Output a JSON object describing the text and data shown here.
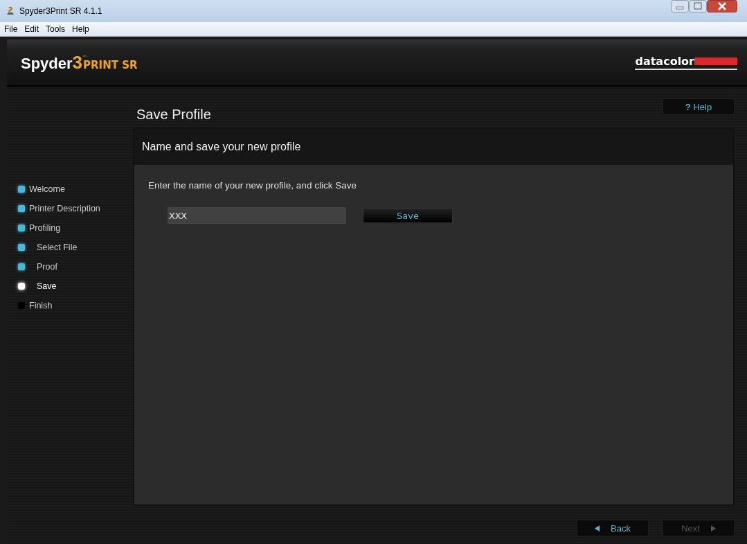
{
  "window": {
    "title": "Spyder3Print SR 4.1.1"
  },
  "menu": [
    "File",
    "Edit",
    "Tools",
    "Help"
  ],
  "logo": {
    "name": "Spyder",
    "number": "3",
    "tm": "™",
    "product": "PRINT SR"
  },
  "brand": "datacolor",
  "steps": [
    {
      "label": "Welcome",
      "kind": "done"
    },
    {
      "label": "Printer Description",
      "kind": "done"
    },
    {
      "label": "Profiling",
      "kind": "done",
      "children": [
        {
          "label": "Select File",
          "kind": "done"
        },
        {
          "label": "Proof",
          "kind": "done"
        },
        {
          "label": "Save",
          "kind": "current"
        }
      ]
    },
    {
      "label": "Finish",
      "kind": "pending"
    }
  ],
  "page_title": "Save Profile",
  "help": {
    "mark": "?",
    "label": "Help"
  },
  "panel": {
    "heading": "Name and save your new profile",
    "instruction": "Enter the name of your new profile, and click Save",
    "name_value": "XXX",
    "save_label": "Save"
  },
  "nav": [
    {
      "label": "Back",
      "kind": "back",
      "disabled": false
    },
    {
      "label": "Next",
      "kind": "next",
      "disabled": true
    }
  ]
}
